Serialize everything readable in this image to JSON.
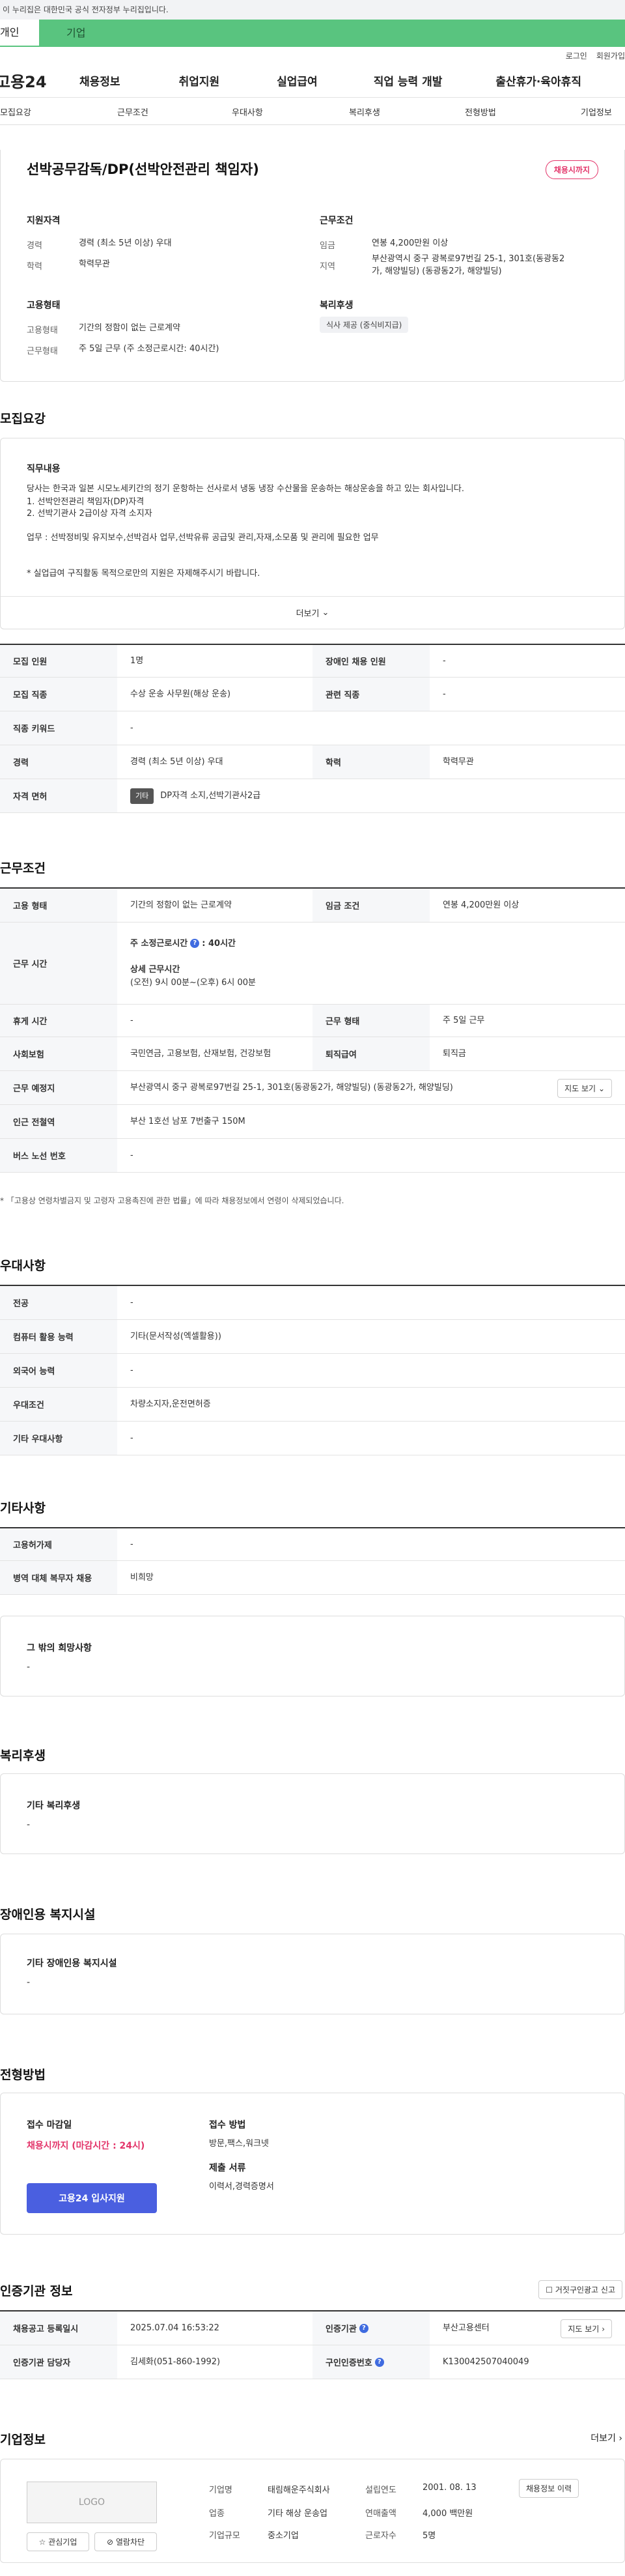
{
  "gov_banner": "이 누리집은 대한민국 공식 전자정부 누리집입니다.",
  "user_tabs": {
    "personal": "개인",
    "company": "기업"
  },
  "top_links": {
    "login": "로그인",
    "join": "회원가입"
  },
  "gnb": {
    "logo": "고용24",
    "items": [
      "채용정보",
      "취업지원",
      "실업급여",
      "직업 능력 개발",
      "출산휴가·육아휴직"
    ]
  },
  "tab_nav": [
    "모집요강",
    "근무조건",
    "우대사항",
    "복리후생",
    "전형방법",
    "기업정보"
  ],
  "summary": {
    "title": "선박공무감독/DP(선박안전관리 책임자)",
    "badge": "채용시까지",
    "qual_heading": "지원자격",
    "career_label": "경력",
    "career_value": "경력 (최소 5년 이상) 우대",
    "edu_label": "학력",
    "edu_value": "학력무관",
    "emp_heading": "고용형태",
    "emp_label": "고용형태",
    "emp_value": "기간의 정함이 없는 근로계약",
    "work_label": "근무형태",
    "work_value": "주 5일 근무 (주 소정근로시간: 40시간)",
    "cond_heading": "근무조건",
    "wage_label": "임금",
    "wage_value": "연봉 4,200만원 이상",
    "region_label": "지역",
    "region_value1": "부산광역시 중구 광복로97번길 25-1, 301호(동광동2",
    "region_value2": "가, 해양빌딩) (동광동2가, 해양빌딩)",
    "welfare_heading": "복리후생",
    "welfare_chip": "식사 제공 (중식비지급)"
  },
  "recruit": {
    "heading": "모집요강",
    "duty_title": "직무내용",
    "duty_lines": [
      "당사는 한국과 일본 시모노세키간의 정기 운항하는 선사로서 냉동 냉장 수산물을 운송하는 해상운송을 하고 있는 회사입니다.",
      "1.   선박안전관리 책임자(DP)자격",
      "2.   선박기관사 2급이상 자격 소지자",
      "업무 : 선박정비및 유지보수,선박검사 업무,선박유류 공급및 관리,자재,소모품 및 관리에 필요한 업무",
      "* 실업급여 구직활동 목적으로만의 지원은 자제해주시기 바랍니다."
    ],
    "more": "더보기",
    "rows": [
      {
        "l1": "모집 인원",
        "v1": "1명",
        "l2": "장애인 채용 인원",
        "v2": "-"
      },
      {
        "l1": "모집 직종",
        "v1": "수상 운송 사무원(해상 운송)",
        "l2": "관련 직종",
        "v2": "-"
      },
      {
        "l1": "직종 키워드",
        "v1": "-"
      },
      {
        "l1": "경력",
        "v1": "경력 (최소 5년 이상) 우대",
        "l2": "학력",
        "v2": "학력무관"
      },
      {
        "l1": "자격 면허",
        "chip": "기타",
        "v1": "DP자격 소지,선박기관사2급"
      }
    ]
  },
  "work": {
    "heading": "근무조건",
    "emp_l": "고용 형태",
    "emp_v": "기간의 정함이 없는 근로계약",
    "wage_l": "임금 조건",
    "wage_v": "연봉 4,200만원 이상",
    "time_l": "근무 시간",
    "time_v1": "주 소정근로시간",
    "time_v1b": ": 40시간",
    "time_v2": "상세 근무시간",
    "time_v3": "(오전) 9시 00분~(오후) 6시 00분",
    "rest_l": "휴게 시간",
    "rest_v": "-",
    "type_l": "근무 형태",
    "type_v": "주 5일 근무",
    "ins_l": "사회보험",
    "ins_v": "국민연금, 고용보험, 산재보험, 건강보험",
    "ret_l": "퇴직급여",
    "ret_v": "퇴직금",
    "place_l": "근무 예정지",
    "place_v": "부산광역시 중구 광복로97번길 25-1, 301호(동광동2가, 해양빌딩) (동광동2가, 해양빌딩)",
    "map_btn": "지도 보기",
    "sub_l": "인근 전철역",
    "sub_v": "부산 1호선 남포 7번출구 150M",
    "bus_l": "버스 노선 번호",
    "bus_v": "-",
    "note": "* 「고용상 연령차별금지 및 고령자 고용촉진에 관한 법률」에 따라 채용정보에서 연령이 삭제되었습니다."
  },
  "pref": {
    "heading": "우대사항",
    "rows": [
      {
        "l": "전공",
        "v": "-"
      },
      {
        "l": "컴퓨터 활용 능력",
        "v": "기타(문서작성(엑셀활용))"
      },
      {
        "l": "외국어 능력",
        "v": "-"
      },
      {
        "l": "우대조건",
        "v": "차량소지자,운전면허증"
      },
      {
        "l": "기타 우대사항",
        "v": "-"
      }
    ]
  },
  "etc": {
    "heading": "기타사항",
    "rows": [
      {
        "l": "고용허가제",
        "v": "-"
      },
      {
        "l": "병역 대체 복무자 채용",
        "v": "비희망"
      }
    ],
    "other_title": "그 밖의 희망사항",
    "other_v": "-"
  },
  "welfare": {
    "heading": "복리후생",
    "box_title": "기타 복리후생",
    "box_v": "-"
  },
  "disabled": {
    "heading": "장애인용 복지시설",
    "box_title": "기타 장애인용 복지시설",
    "box_v": "-"
  },
  "process": {
    "heading": "전형방법",
    "deadline_l": "접수 마감일",
    "deadline_v": "채용시까지 (마감시간 : 24시)",
    "method_l": "접수 방법",
    "method_v": "방문,팩스,워크넷",
    "docs_l": "제출 서류",
    "docs_v": "이력서,경력증명서",
    "apply_btn": "고용24 입사지원"
  },
  "cert": {
    "heading": "인증기관 정보",
    "report_btn": "거짓구인광고 신고",
    "reg_l": "채용공고 등록일시",
    "reg_v": "2025.07.04 16:53:22",
    "org_l": "인증기관",
    "org_v": "부산고용센터",
    "map_btn": "지도 보기",
    "mgr_l": "인증기관 담당자",
    "mgr_v": "김세화(051-860-1992)",
    "no_l": "구인인증번호",
    "no_v": "K130042507040049"
  },
  "company": {
    "heading": "기업정보",
    "more": "더보기",
    "logo": "LOGO",
    "fav": "관심기업",
    "block": "열람차단",
    "name_l": "기업명",
    "name_v": "태림해운주식회사",
    "year_l": "설립연도",
    "year_v": "2001. 08. 13",
    "history_btn": "채용정보 이력",
    "biz_l": "업종",
    "biz_v": "기타 해상 운송업",
    "sales_l": "연매출액",
    "sales_v": "4,000 백만원",
    "size_l": "기업규모",
    "size_v": "중소기업",
    "emp_l": "근로자수",
    "emp_v": "5명"
  }
}
